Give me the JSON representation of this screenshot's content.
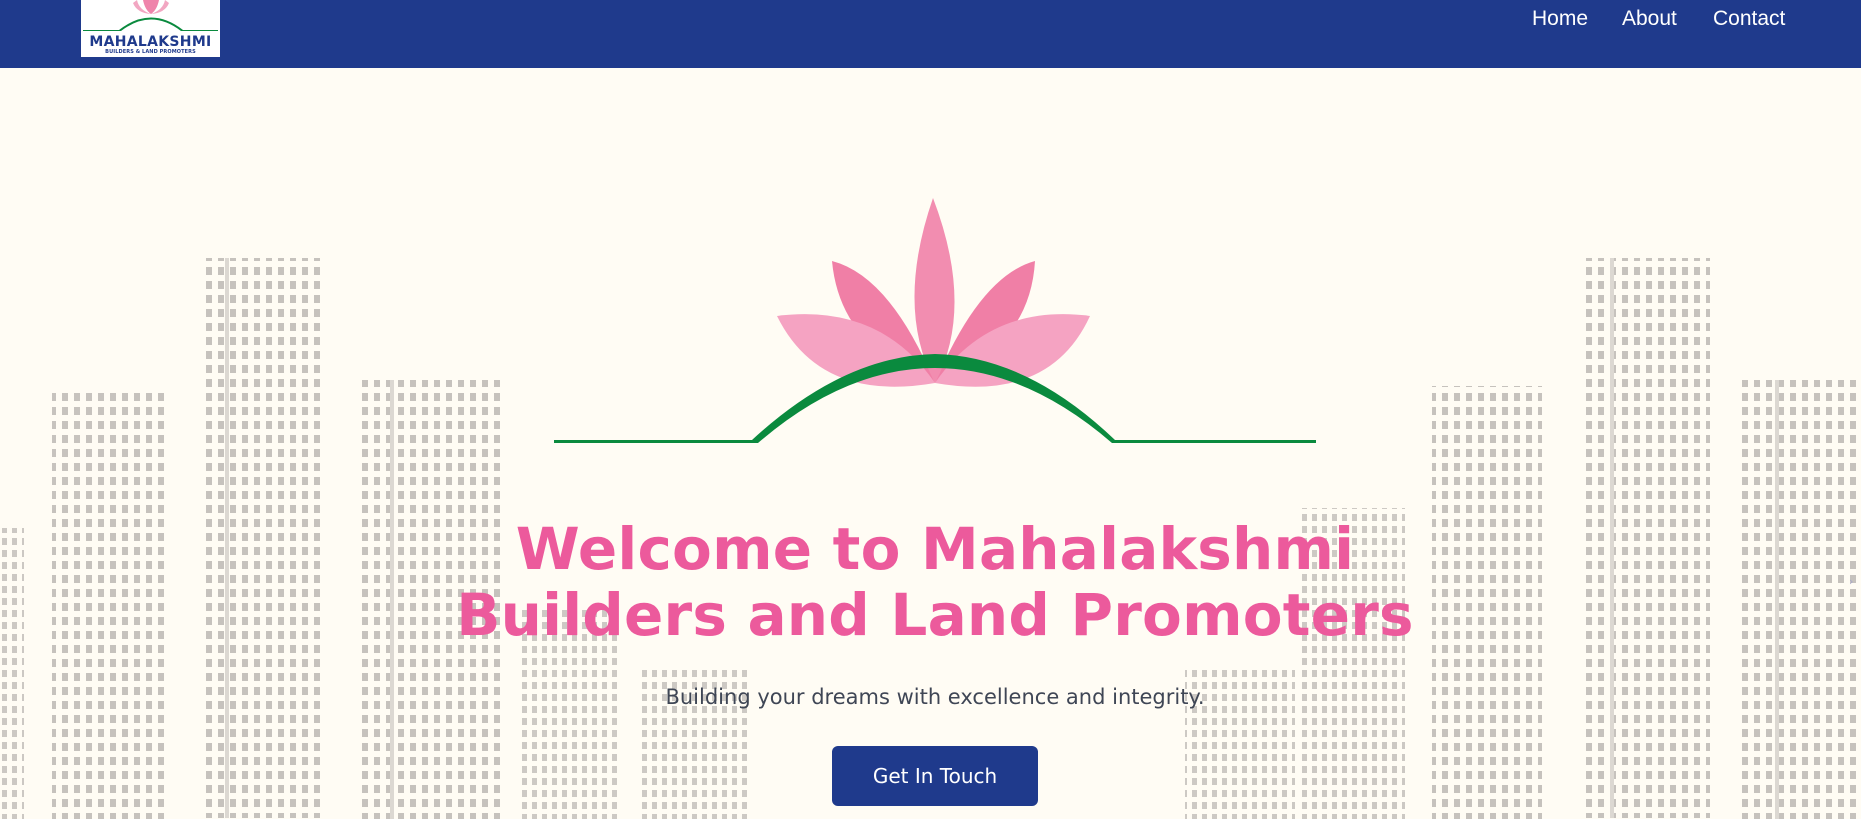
{
  "header": {
    "logo": {
      "name": "MAHALAKSHMI",
      "tagline": "BUILDERS & LAND PROMOTERS"
    },
    "nav": [
      {
        "label": "Home"
      },
      {
        "label": "About"
      },
      {
        "label": "Contact"
      }
    ]
  },
  "hero": {
    "title_line1": "Welcome to Mahalakshmi",
    "title_line2": "Builders and Land Promoters",
    "subtitle": "Building your dreams with excellence and integrity.",
    "cta_label": "Get In Touch",
    "edge_glyph": "›"
  },
  "colors": {
    "brand_blue": "#1f3a8c",
    "title_pink": "#ec5a9c",
    "lotus_pink": "#f4a3c1",
    "leaf_green": "#0a8a3e",
    "background": "#fffcf4"
  }
}
